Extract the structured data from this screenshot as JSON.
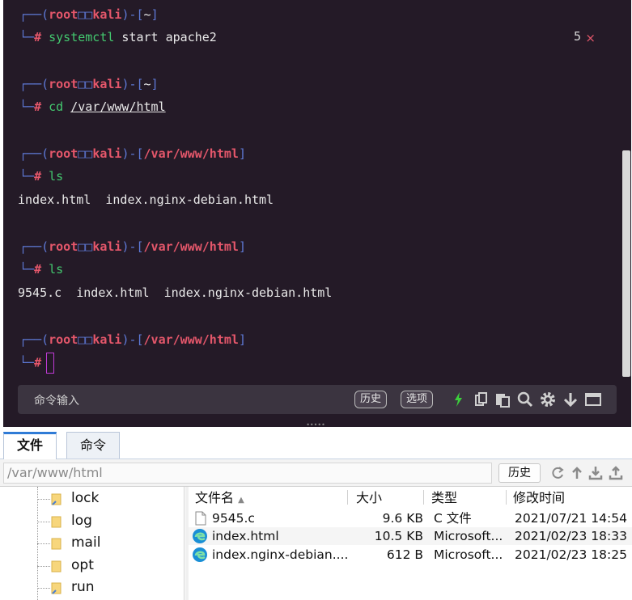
{
  "terminal": {
    "prompt_user": "root",
    "prompt_host": "kali",
    "home_dir": "~",
    "web_dir": "/var/www/html",
    "blocks": [
      {
        "dir": "~",
        "cmd_name": "systemctl",
        "cmd_args": " start apache2",
        "output": ""
      },
      {
        "dir": "~",
        "cmd_name": "cd",
        "cmd_args": "/var/www/html",
        "output": ""
      },
      {
        "dir": "/var/www/html",
        "cmd_name": "ls",
        "cmd_args": "",
        "output": "index.html  index.nginx-debian.html"
      },
      {
        "dir": "/var/www/html",
        "cmd_name": "ls",
        "cmd_args": "",
        "output": "9545.c  index.html  index.nginx-debian.html"
      },
      {
        "dir": "/var/www/html",
        "cmd_name": "",
        "cmd_args": "",
        "output": ""
      }
    ],
    "exit_code": "5",
    "exit_mark": "×",
    "command_bar": {
      "placeholder": "命令输入",
      "history_label": "历史",
      "options_label": "选项"
    }
  },
  "tabs": [
    {
      "label": "文件",
      "active": true
    },
    {
      "label": "命令",
      "active": false
    }
  ],
  "pathbar": {
    "path": "/var/www/html",
    "history_label": "历史"
  },
  "tree": {
    "items": [
      "lock",
      "log",
      "mail",
      "opt",
      "run"
    ]
  },
  "filelist": {
    "headers": {
      "name": "文件名",
      "size": "大小",
      "type": "类型",
      "modified": "修改时间"
    },
    "rows": [
      {
        "name": "9545.c",
        "size": "9.6 KB",
        "type": "C 文件",
        "modified": "2021/07/21 14:54",
        "icon": "c-file-icon"
      },
      {
        "name": "index.html",
        "size": "10.5 KB",
        "type": "Microsoft...",
        "modified": "2021/02/23 18:33",
        "icon": "edge-icon"
      },
      {
        "name": "index.nginx-debian....",
        "size": "612 B",
        "type": "Microsoft...",
        "modified": "2021/02/23 18:25",
        "icon": "edge-icon"
      }
    ]
  },
  "colors": {
    "terminal_bg": "#241a27",
    "prompt_frame": "#5e79d6",
    "prompt_user": "#e5576b",
    "command": "#43c96f",
    "accent_tab": "#2f7bd6"
  }
}
